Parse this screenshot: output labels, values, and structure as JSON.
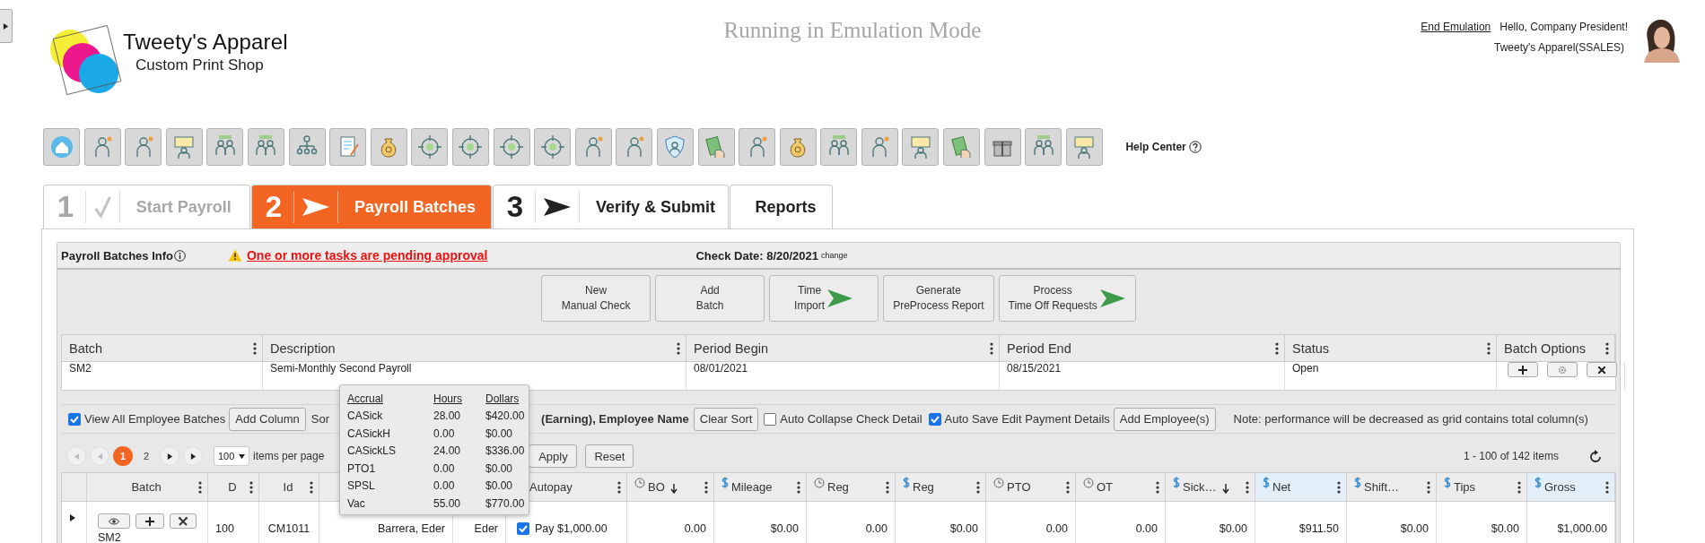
{
  "brand": {
    "name": "Tweety's Apparel",
    "tagline": "Custom Print Shop"
  },
  "mode_banner": "Running in Emulation Mode",
  "user": {
    "end_emulation": "End Emulation",
    "greeting": "Hello, Company President!",
    "company": "Tweety's Apparel(SSALES)"
  },
  "help_center": "Help Center",
  "steps": [
    {
      "number": "1",
      "label": "Start Payroll",
      "kind": "completed",
      "selected": false,
      "disabled": true
    },
    {
      "number": "2",
      "label": "Payroll Batches",
      "kind": "pending",
      "selected": true,
      "disabled": false
    },
    {
      "number": "3",
      "label": "Verify & Submit",
      "kind": "pending",
      "selected": false,
      "disabled": false
    },
    {
      "label": "Reports",
      "kind": "report",
      "selected": false,
      "disabled": false
    }
  ],
  "panel": {
    "title": "Payroll Batches Info",
    "warning": "One or more tasks are pending approval",
    "check_date": "Check Date: 8/20/2021",
    "change_link": "change",
    "actions": [
      {
        "label": "New\nManual Check",
        "arrow": false
      },
      {
        "label": "Add\nBatch",
        "arrow": false
      },
      {
        "label": "Time\nImport",
        "arrow": true
      },
      {
        "label": "Generate\nPreProcess Report",
        "arrow": false
      },
      {
        "label": "Process\nTime Off Requests",
        "arrow": true
      }
    ]
  },
  "batch_grid": {
    "columns": [
      "Batch",
      "Description",
      "Period Begin",
      "Period End",
      "Status",
      "Batch Options"
    ],
    "rows": [
      {
        "cells": [
          "SM2",
          "Semi-Monthly Second Payroll",
          "08/01/2021",
          "08/15/2021",
          "Open"
        ]
      }
    ]
  },
  "grid_toolbar": {
    "view_all": {
      "label": "View All Employee Batches",
      "checked": true
    },
    "add_column": "Add Column",
    "sort_prefix": "Sor",
    "sort_fields": "(Earning), Employee Name",
    "clear_sort": "Clear Sort",
    "auto_collapse": {
      "label": "Auto Collapse Check Detail",
      "checked": false
    },
    "auto_save": {
      "label": "Auto Save Edit Payment Details",
      "checked": true
    },
    "add_employees": "Add Employee(s)",
    "note": "Note: performance will be decreased as grid contains total column(s)"
  },
  "pager": {
    "pages": [
      {
        "label": "1",
        "selected": true
      },
      {
        "label": "2",
        "selected": false
      }
    ],
    "page_size": "100",
    "page_size_label": "items per page",
    "apply": "Apply",
    "reset": "Reset",
    "summary": "1 - 100 of 142 items"
  },
  "employee_grid": {
    "columns": [
      {
        "kind": "batch",
        "label": "Batch",
        "sorted": false,
        "highlighted": false
      },
      {
        "kind": "number",
        "label": "D",
        "sorted": false,
        "highlighted": false
      },
      {
        "kind": "code",
        "label": "Id",
        "sorted": false,
        "highlighted": false
      },
      {
        "kind": "covered"
      },
      {
        "kind": "covered"
      },
      {
        "kind": "autopay",
        "label": "Autopay",
        "sorted": false,
        "highlighted": false
      },
      {
        "kind": "hours",
        "label": "BO",
        "sorted": true,
        "highlighted": false
      },
      {
        "kind": "dollars",
        "label": "Mileage",
        "sorted": false,
        "highlighted": false
      },
      {
        "kind": "hours",
        "label": "Reg",
        "sorted": false,
        "highlighted": false
      },
      {
        "kind": "dollars",
        "label": "Reg",
        "sorted": false,
        "highlighted": false
      },
      {
        "kind": "hours",
        "label": "PTO",
        "sorted": false,
        "highlighted": false
      },
      {
        "kind": "hours",
        "label": "OT",
        "sorted": false,
        "highlighted": false
      },
      {
        "kind": "dollars",
        "label": "Sick…",
        "sorted": true,
        "highlighted": false
      },
      {
        "kind": "dollars",
        "label": "Net",
        "sorted": false,
        "highlighted": true
      },
      {
        "kind": "dollars",
        "label": "Shift…",
        "sorted": false,
        "highlighted": false
      },
      {
        "kind": "dollars",
        "label": "Tips",
        "sorted": false,
        "highlighted": false
      },
      {
        "kind": "dollars",
        "label": "Gross",
        "sorted": false,
        "highlighted": true
      }
    ],
    "rows": [
      {
        "autopay_checked": true,
        "cells": [
          "SM2",
          "100",
          "CM1011",
          "Barrera, Eder",
          "Eder",
          "Pay $1,000.00",
          "0.00",
          "$0.00",
          "0.00",
          "$0.00",
          "0.00",
          "0.00",
          "$0.00",
          "$911.50",
          "$0.00",
          "$0.00",
          "$1,000.00"
        ]
      }
    ]
  },
  "accrual_tooltip": {
    "columns": [
      "Accrual",
      "Hours",
      "Dollars"
    ],
    "rows": [
      [
        "CASick",
        "28.00",
        "$420.00"
      ],
      [
        "CASickH",
        "0.00",
        "$0.00"
      ],
      [
        "CASickLS",
        "24.00",
        "$336.00"
      ],
      [
        "PTO1",
        "0.00",
        "$0.00"
      ],
      [
        "SPSL",
        "0.00",
        "$0.00"
      ],
      [
        "Vac",
        "55.00",
        "$770.00"
      ]
    ]
  }
}
